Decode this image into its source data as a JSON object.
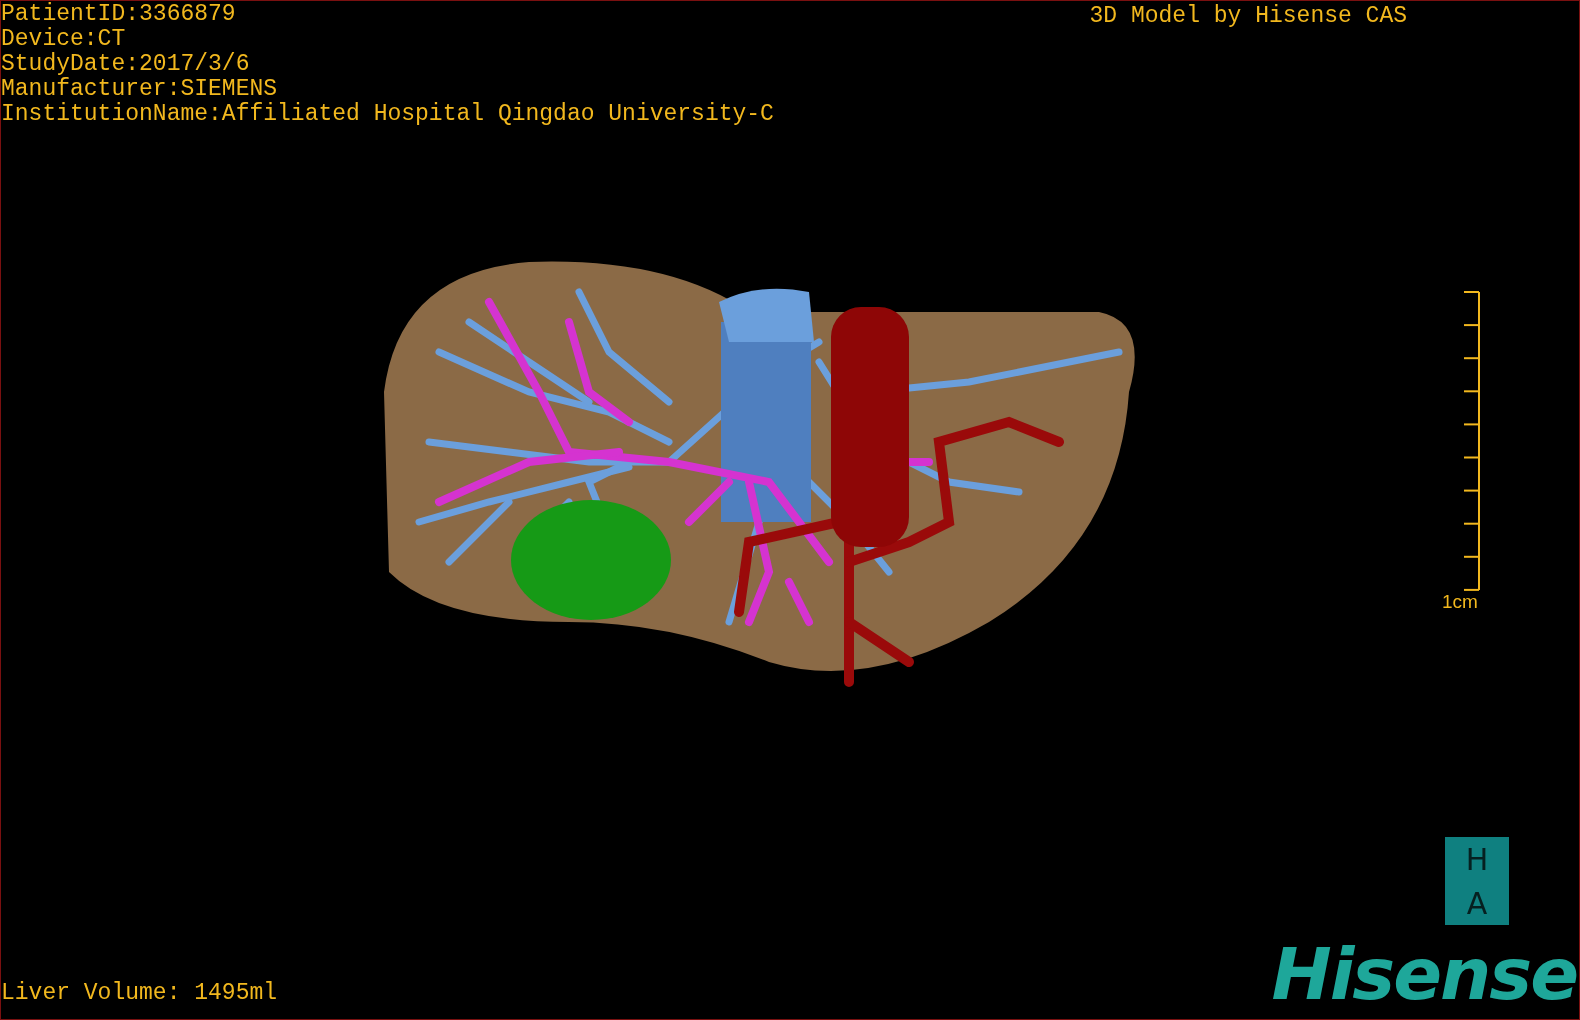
{
  "info_lines": [
    "PatientID:3366879",
    "Device:CT",
    "StudyDate:2017/3/6",
    "Manufacturer:SIEMENS",
    "InstitutionName:Affiliated Hospital Qingdao University-C"
  ],
  "title": "3D Model by Hisense CAS",
  "scale_bar": {
    "label": "1cm"
  },
  "liver_volume": "Liver Volume: 1495ml",
  "logo": {
    "tiles": [
      "H",
      "A"
    ],
    "wordmark": "Hisense"
  }
}
